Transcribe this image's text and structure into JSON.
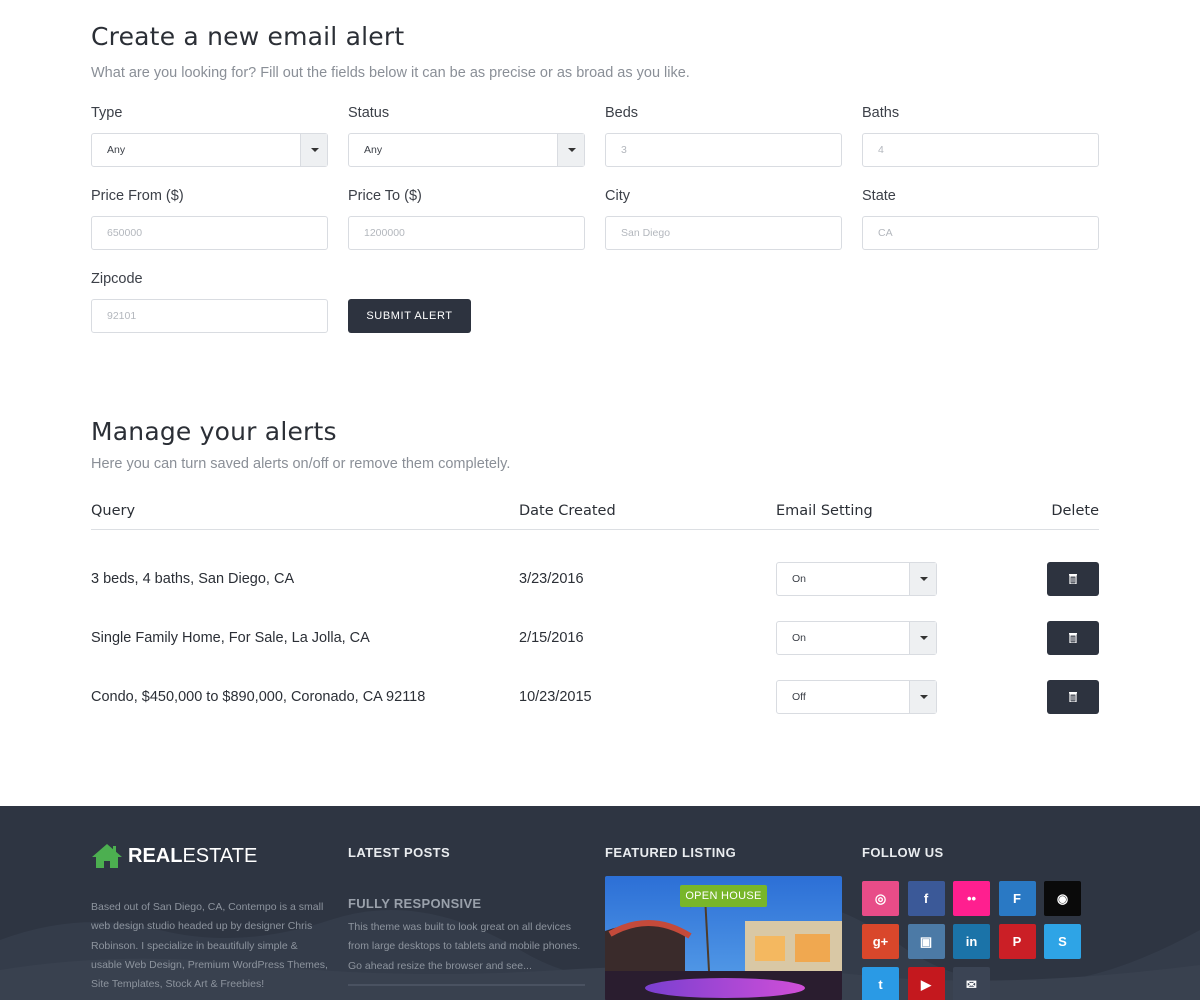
{
  "create": {
    "title": "Create a new email alert",
    "subtitle": "What are you looking for? Fill out the fields below it can be as precise or as broad as you like.",
    "fields": [
      {
        "label": "Type",
        "value": "Any",
        "kind": "select"
      },
      {
        "label": "Status",
        "value": "Any",
        "kind": "select"
      },
      {
        "label": "Beds",
        "placeholder": "3",
        "kind": "input"
      },
      {
        "label": "Baths",
        "placeholder": "4",
        "kind": "input"
      },
      {
        "label": "Price From ($)",
        "placeholder": "650000",
        "kind": "input"
      },
      {
        "label": "Price To ($)",
        "placeholder": "1200000",
        "kind": "input"
      },
      {
        "label": "City",
        "placeholder": "San Diego",
        "kind": "input"
      },
      {
        "label": "State",
        "placeholder": "CA",
        "kind": "input"
      },
      {
        "label": "Zipcode",
        "placeholder": "92101",
        "kind": "input"
      }
    ],
    "submit_label": "SUBMIT ALERT"
  },
  "manage": {
    "title": "Manage your alerts",
    "subtitle": "Here you can turn saved alerts on/off or remove them completely.",
    "columns": [
      "Query",
      "Date Created",
      "Email Setting",
      "Delete"
    ],
    "rows": [
      {
        "query": "3 beds, 4 baths, San Diego, CA",
        "date": "3/23/2016",
        "setting": "On"
      },
      {
        "query": "Single Family Home, For Sale, La Jolla, CA",
        "date": "2/15/2016",
        "setting": "On"
      },
      {
        "query": "Condo, $450,000 to $890,000, Coronado, CA 92118",
        "date": "10/23/2015",
        "setting": "Off"
      }
    ]
  },
  "footer": {
    "logo_bold": "REAL",
    "logo_light": "ESTATE",
    "about": "Based out of San Diego, CA, Contempo is a small web design studio headed up by designer Chris Robinson. I specialize in beautifully simple & usable Web Design, Premium WordPress Themes, Site Templates, Stock Art & Freebies!",
    "latest_posts_title": "LATEST POSTS",
    "post_title": "FULLY RESPONSIVE",
    "post_excerpt": "This theme was built to look great on all devices from large desktops to tablets and mobile phones. Go ahead resize the browser and see...",
    "featured_title": "FEATURED LISTING",
    "featured_badge": "OPEN HOUSE",
    "follow_title": "FOLLOW US",
    "social": [
      {
        "name": "dribbble-icon",
        "color": "#e84c88",
        "glyph": "◎"
      },
      {
        "name": "facebook-icon",
        "color": "#3b5998",
        "glyph": "f"
      },
      {
        "name": "flickr-icon",
        "color": "#ff1f8f",
        "glyph": "••"
      },
      {
        "name": "foursquare-icon",
        "color": "#2a79c4",
        "glyph": "F"
      },
      {
        "name": "github-icon",
        "color": "#0a0a0a",
        "glyph": "◉"
      },
      {
        "name": "google-plus-icon",
        "color": "#d9472b",
        "glyph": "g+"
      },
      {
        "name": "instagram-icon",
        "color": "#4c7aa6",
        "glyph": "▣"
      },
      {
        "name": "linkedin-icon",
        "color": "#1b73a8",
        "glyph": "in"
      },
      {
        "name": "pinterest-icon",
        "color": "#cb1f26",
        "glyph": "P"
      },
      {
        "name": "skype-icon",
        "color": "#2ea4e6",
        "glyph": "S"
      },
      {
        "name": "twitter-icon",
        "color": "#2a9ae5",
        "glyph": "t"
      },
      {
        "name": "youtube-icon",
        "color": "#c4181e",
        "glyph": "▶"
      },
      {
        "name": "email-icon",
        "color": "#3b4454",
        "glyph": "✉"
      }
    ]
  }
}
